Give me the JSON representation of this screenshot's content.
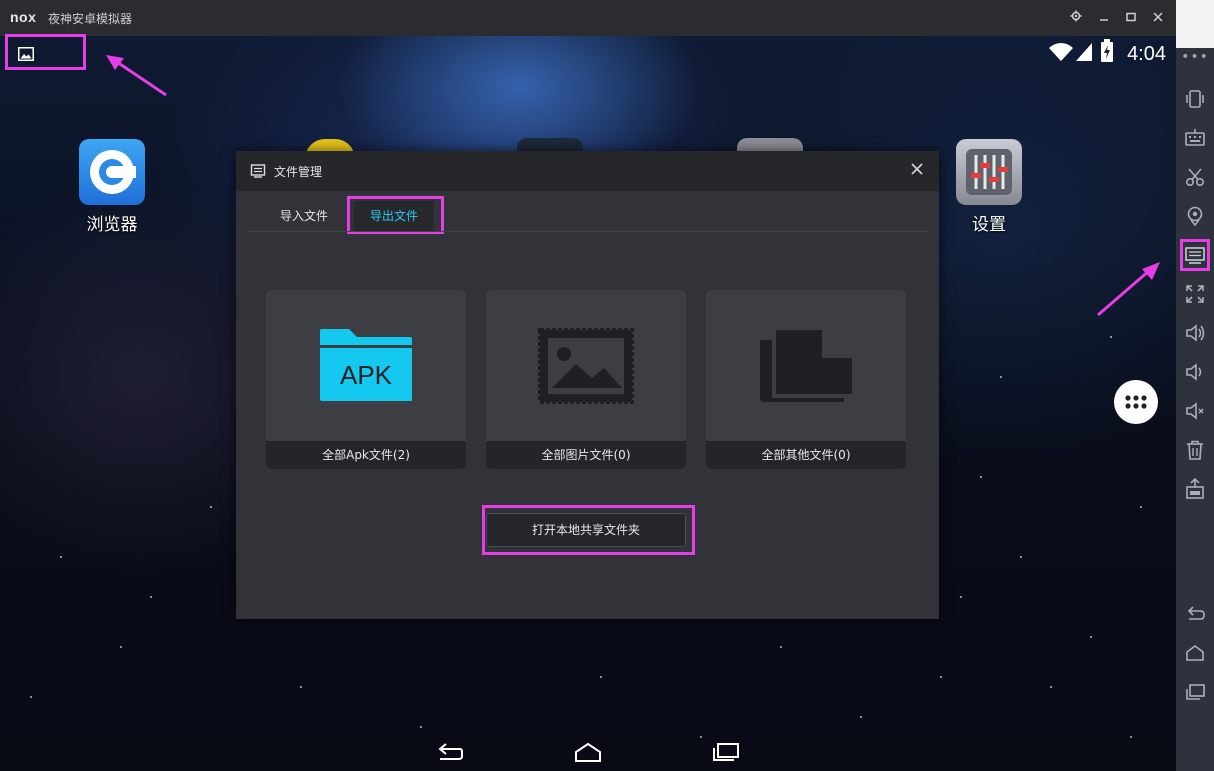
{
  "window": {
    "logo": "nox",
    "title": "夜神安卓模拟器"
  },
  "status": {
    "time": "4:04"
  },
  "desktop": {
    "apps": [
      {
        "label": "浏览器"
      },
      {
        "label": "设置"
      }
    ]
  },
  "dialog": {
    "title": "文件管理",
    "tabs": [
      {
        "label": "导入文件",
        "active": false
      },
      {
        "label": "导出文件",
        "active": true
      }
    ],
    "cards": [
      {
        "icon": "apk-folder-icon",
        "badge": "APK",
        "label": "全部Apk文件(2)"
      },
      {
        "icon": "image-icon",
        "label": "全部图片文件(0)"
      },
      {
        "icon": "documents-icon",
        "label": "全部其他文件(0)"
      }
    ],
    "open_button": "打开本地共享文件夹"
  },
  "sidebar": {
    "icons": [
      "shake-icon",
      "keyboard-icon",
      "scissors-icon",
      "location-icon",
      "file-manager-icon",
      "fullscreen-icon",
      "volume-up-icon",
      "volume-down-icon",
      "mute-icon",
      "trash-icon",
      "apk-install-icon",
      "back-icon",
      "home-icon",
      "recent-apps-icon"
    ]
  },
  "colors": {
    "highlight": "#e63ee6",
    "accent": "#2ec8ef",
    "dialog_bg": "#323338"
  }
}
